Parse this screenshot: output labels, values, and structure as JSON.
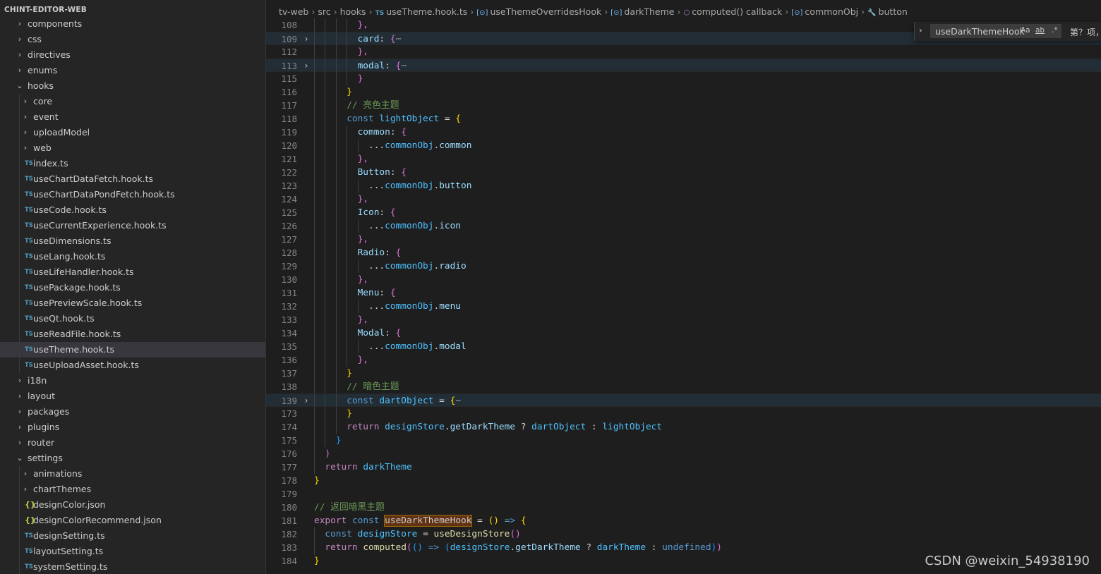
{
  "explorer": {
    "title": "CHINT-EDITOR-WEB",
    "items": [
      {
        "label": "components",
        "type": "folder",
        "depth": 0,
        "open": false
      },
      {
        "label": "css",
        "type": "folder",
        "depth": 0,
        "open": false
      },
      {
        "label": "directives",
        "type": "folder",
        "depth": 0,
        "open": false
      },
      {
        "label": "enums",
        "type": "folder",
        "depth": 0,
        "open": false
      },
      {
        "label": "hooks",
        "type": "folder",
        "depth": 0,
        "open": true
      },
      {
        "label": "core",
        "type": "folder",
        "depth": 1,
        "open": false
      },
      {
        "label": "event",
        "type": "folder",
        "depth": 1,
        "open": false
      },
      {
        "label": "uploadModel",
        "type": "folder",
        "depth": 1,
        "open": false
      },
      {
        "label": "web",
        "type": "folder",
        "depth": 1,
        "open": false
      },
      {
        "label": "index.ts",
        "type": "ts",
        "depth": 1
      },
      {
        "label": "useChartDataFetch.hook.ts",
        "type": "ts",
        "depth": 1
      },
      {
        "label": "useChartDataPondFetch.hook.ts",
        "type": "ts",
        "depth": 1
      },
      {
        "label": "useCode.hook.ts",
        "type": "ts",
        "depth": 1
      },
      {
        "label": "useCurrentExperience.hook.ts",
        "type": "ts",
        "depth": 1
      },
      {
        "label": "useDimensions.ts",
        "type": "ts",
        "depth": 1
      },
      {
        "label": "useLang.hook.ts",
        "type": "ts",
        "depth": 1
      },
      {
        "label": "useLifeHandler.hook.ts",
        "type": "ts",
        "depth": 1
      },
      {
        "label": "usePackage.hook.ts",
        "type": "ts",
        "depth": 1
      },
      {
        "label": "usePreviewScale.hook.ts",
        "type": "ts",
        "depth": 1
      },
      {
        "label": "useQt.hook.ts",
        "type": "ts",
        "depth": 1
      },
      {
        "label": "useReadFile.hook.ts",
        "type": "ts",
        "depth": 1
      },
      {
        "label": "useTheme.hook.ts",
        "type": "ts",
        "depth": 1,
        "selected": true
      },
      {
        "label": "useUploadAsset.hook.ts",
        "type": "ts",
        "depth": 1
      },
      {
        "label": "i18n",
        "type": "folder",
        "depth": 0,
        "open": false
      },
      {
        "label": "layout",
        "type": "folder",
        "depth": 0,
        "open": false
      },
      {
        "label": "packages",
        "type": "folder",
        "depth": 0,
        "open": false
      },
      {
        "label": "plugins",
        "type": "folder",
        "depth": 0,
        "open": false
      },
      {
        "label": "router",
        "type": "folder",
        "depth": 0,
        "open": false
      },
      {
        "label": "settings",
        "type": "folder",
        "depth": 0,
        "open": true
      },
      {
        "label": "animations",
        "type": "folder",
        "depth": 1,
        "open": false
      },
      {
        "label": "chartThemes",
        "type": "folder",
        "depth": 1,
        "open": false
      },
      {
        "label": "designColor.json",
        "type": "json",
        "depth": 1
      },
      {
        "label": "designColorRecommend.json",
        "type": "json",
        "depth": 1
      },
      {
        "label": "designSetting.ts",
        "type": "ts",
        "depth": 1
      },
      {
        "label": "layoutSetting.ts",
        "type": "ts",
        "depth": 1
      },
      {
        "label": "systemSetting.ts",
        "type": "ts",
        "depth": 1
      }
    ]
  },
  "icons": {
    "chevron_right": "›",
    "chevron_down": "⌄",
    "ts_badge": "TS",
    "json_badge": "{}",
    "symbol_variable": "[⊙]",
    "symbol_method": "⬡",
    "wrench": "🔧"
  },
  "breadcrumb": [
    {
      "label": "tv-web",
      "icon": ""
    },
    {
      "label": "src",
      "icon": ""
    },
    {
      "label": "hooks",
      "icon": ""
    },
    {
      "label": "useTheme.hook.ts",
      "icon": "ts"
    },
    {
      "label": "useThemeOverridesHook",
      "icon": "var"
    },
    {
      "label": "darkTheme",
      "icon": "var"
    },
    {
      "label": "computed() callback",
      "icon": "cube"
    },
    {
      "label": "commonObj",
      "icon": "var"
    },
    {
      "label": "button",
      "icon": "wrench"
    }
  ],
  "find_widget": {
    "value": "useDarkThemeHook",
    "match_case": "Aa",
    "whole_word": "ab",
    "regex": ".*",
    "result_text": "第？项，"
  },
  "editor": {
    "lines": [
      {
        "n": "108",
        "indent": 4,
        "tokens": [
          [
            "b2",
            "},"
          ]
        ]
      },
      {
        "n": "109",
        "indent": 4,
        "fold": true,
        "hl": true,
        "tokens": [
          [
            "prop",
            "card"
          ],
          [
            "op",
            ": "
          ],
          [
            "b2",
            "{"
          ],
          [
            "dots",
            "⋯"
          ]
        ]
      },
      {
        "n": "112",
        "indent": 4,
        "tokens": [
          [
            "b2",
            "},"
          ]
        ]
      },
      {
        "n": "113",
        "indent": 4,
        "fold": true,
        "hl": true,
        "tokens": [
          [
            "prop",
            "modal"
          ],
          [
            "op",
            ": "
          ],
          [
            "b2",
            "{"
          ],
          [
            "dots",
            "⋯"
          ]
        ]
      },
      {
        "n": "115",
        "indent": 4,
        "tokens": [
          [
            "b2",
            "}"
          ]
        ]
      },
      {
        "n": "116",
        "indent": 3,
        "tokens": [
          [
            "b1",
            "}"
          ]
        ]
      },
      {
        "n": "117",
        "indent": 3,
        "tokens": [
          [
            "cm",
            "// 亮色主题"
          ]
        ]
      },
      {
        "n": "118",
        "indent": 3,
        "tokens": [
          [
            "kw",
            "const "
          ],
          [
            "var",
            "lightObject"
          ],
          [
            "op",
            " = "
          ],
          [
            "b1",
            "{"
          ]
        ]
      },
      {
        "n": "119",
        "indent": 4,
        "tokens": [
          [
            "prop",
            "common"
          ],
          [
            "op",
            ": "
          ],
          [
            "b2",
            "{"
          ]
        ]
      },
      {
        "n": "120",
        "indent": 5,
        "tokens": [
          [
            "op",
            "..."
          ],
          [
            "var",
            "commonObj"
          ],
          [
            "op",
            "."
          ],
          [
            "prop",
            "common"
          ]
        ]
      },
      {
        "n": "121",
        "indent": 4,
        "tokens": [
          [
            "b2",
            "},"
          ]
        ]
      },
      {
        "n": "122",
        "indent": 4,
        "tokens": [
          [
            "prop",
            "Button"
          ],
          [
            "op",
            ": "
          ],
          [
            "b2",
            "{"
          ]
        ]
      },
      {
        "n": "123",
        "indent": 5,
        "tokens": [
          [
            "op",
            "..."
          ],
          [
            "var",
            "commonObj"
          ],
          [
            "op",
            "."
          ],
          [
            "prop",
            "button"
          ]
        ]
      },
      {
        "n": "124",
        "indent": 4,
        "tokens": [
          [
            "b2",
            "},"
          ]
        ]
      },
      {
        "n": "125",
        "indent": 4,
        "tokens": [
          [
            "prop",
            "Icon"
          ],
          [
            "op",
            ": "
          ],
          [
            "b2",
            "{"
          ]
        ]
      },
      {
        "n": "126",
        "indent": 5,
        "tokens": [
          [
            "op",
            "..."
          ],
          [
            "var",
            "commonObj"
          ],
          [
            "op",
            "."
          ],
          [
            "prop",
            "icon"
          ]
        ]
      },
      {
        "n": "127",
        "indent": 4,
        "tokens": [
          [
            "b2",
            "},"
          ]
        ]
      },
      {
        "n": "128",
        "indent": 4,
        "tokens": [
          [
            "prop",
            "Radio"
          ],
          [
            "op",
            ": "
          ],
          [
            "b2",
            "{"
          ]
        ]
      },
      {
        "n": "129",
        "indent": 5,
        "tokens": [
          [
            "op",
            "..."
          ],
          [
            "var",
            "commonObj"
          ],
          [
            "op",
            "."
          ],
          [
            "prop",
            "radio"
          ]
        ]
      },
      {
        "n": "130",
        "indent": 4,
        "tokens": [
          [
            "b2",
            "},"
          ]
        ]
      },
      {
        "n": "131",
        "indent": 4,
        "tokens": [
          [
            "prop",
            "Menu"
          ],
          [
            "op",
            ": "
          ],
          [
            "b2",
            "{"
          ]
        ]
      },
      {
        "n": "132",
        "indent": 5,
        "tokens": [
          [
            "op",
            "..."
          ],
          [
            "var",
            "commonObj"
          ],
          [
            "op",
            "."
          ],
          [
            "prop",
            "menu"
          ]
        ]
      },
      {
        "n": "133",
        "indent": 4,
        "tokens": [
          [
            "b2",
            "},"
          ]
        ]
      },
      {
        "n": "134",
        "indent": 4,
        "tokens": [
          [
            "prop",
            "Modal"
          ],
          [
            "op",
            ": "
          ],
          [
            "b2",
            "{"
          ]
        ]
      },
      {
        "n": "135",
        "indent": 5,
        "tokens": [
          [
            "op",
            "..."
          ],
          [
            "var",
            "commonObj"
          ],
          [
            "op",
            "."
          ],
          [
            "prop",
            "modal"
          ]
        ]
      },
      {
        "n": "136",
        "indent": 4,
        "tokens": [
          [
            "b2",
            "},"
          ]
        ]
      },
      {
        "n": "137",
        "indent": 3,
        "tokens": [
          [
            "b1",
            "}"
          ]
        ]
      },
      {
        "n": "138",
        "indent": 3,
        "tokens": [
          [
            "cm",
            "// 暗色主题"
          ]
        ]
      },
      {
        "n": "139",
        "indent": 3,
        "fold": true,
        "hl": true,
        "tokens": [
          [
            "kw",
            "const "
          ],
          [
            "var",
            "dartObject"
          ],
          [
            "op",
            " = "
          ],
          [
            "b1",
            "{"
          ],
          [
            "dots",
            "⋯"
          ]
        ]
      },
      {
        "n": "173",
        "indent": 3,
        "tokens": [
          [
            "b1",
            "}"
          ]
        ]
      },
      {
        "n": "174",
        "indent": 3,
        "tokens": [
          [
            "ctl",
            "return "
          ],
          [
            "var",
            "designStore"
          ],
          [
            "op",
            "."
          ],
          [
            "prop",
            "getDarkTheme"
          ],
          [
            "op",
            " ? "
          ],
          [
            "var",
            "dartObject"
          ],
          [
            "op",
            " : "
          ],
          [
            "var",
            "lightObject"
          ]
        ]
      },
      {
        "n": "175",
        "indent": 2,
        "tokens": [
          [
            "b3",
            "}"
          ]
        ]
      },
      {
        "n": "176",
        "indent": 1,
        "tokens": [
          [
            "b2",
            ")"
          ]
        ]
      },
      {
        "n": "177",
        "indent": 1,
        "tokens": [
          [
            "ctl",
            "return "
          ],
          [
            "var",
            "darkTheme"
          ]
        ]
      },
      {
        "n": "178",
        "indent": 0,
        "tokens": [
          [
            "b1",
            "}"
          ]
        ]
      },
      {
        "n": "179",
        "indent": 0,
        "tokens": []
      },
      {
        "n": "180",
        "indent": 0,
        "tokens": [
          [
            "cm",
            "// 返回暗黑主题"
          ]
        ]
      },
      {
        "n": "181",
        "indent": 0,
        "tokens": [
          [
            "ctl",
            "export "
          ],
          [
            "kw",
            "const "
          ],
          [
            "match",
            "useDarkThemeHook"
          ],
          [
            "op",
            " = "
          ],
          [
            "b1",
            "()"
          ],
          [
            "op",
            " "
          ],
          [
            "kw",
            "=>"
          ],
          [
            "op",
            " "
          ],
          [
            "b1",
            "{"
          ]
        ]
      },
      {
        "n": "182",
        "indent": 1,
        "tokens": [
          [
            "kw",
            "const "
          ],
          [
            "var",
            "designStore"
          ],
          [
            "op",
            " = "
          ],
          [
            "fn",
            "useDesignStore"
          ],
          [
            "b2",
            "()"
          ]
        ]
      },
      {
        "n": "183",
        "indent": 1,
        "tokens": [
          [
            "ctl",
            "return "
          ],
          [
            "fn",
            "computed"
          ],
          [
            "b2",
            "("
          ],
          [
            "b3",
            "()"
          ],
          [
            "op",
            " "
          ],
          [
            "kw",
            "=>"
          ],
          [
            "op",
            " "
          ],
          [
            "b3",
            "("
          ],
          [
            "var",
            "designStore"
          ],
          [
            "op",
            "."
          ],
          [
            "prop",
            "getDarkTheme"
          ],
          [
            "op",
            " ? "
          ],
          [
            "var",
            "darkTheme"
          ],
          [
            "op",
            " : "
          ],
          [
            "kw",
            "undefined"
          ],
          [
            "b3",
            ")"
          ],
          [
            "b2",
            ")"
          ]
        ]
      },
      {
        "n": "184",
        "indent": 0,
        "tokens": [
          [
            "b1",
            "}"
          ]
        ]
      }
    ]
  },
  "watermark": "CSDN @weixin_54938190"
}
